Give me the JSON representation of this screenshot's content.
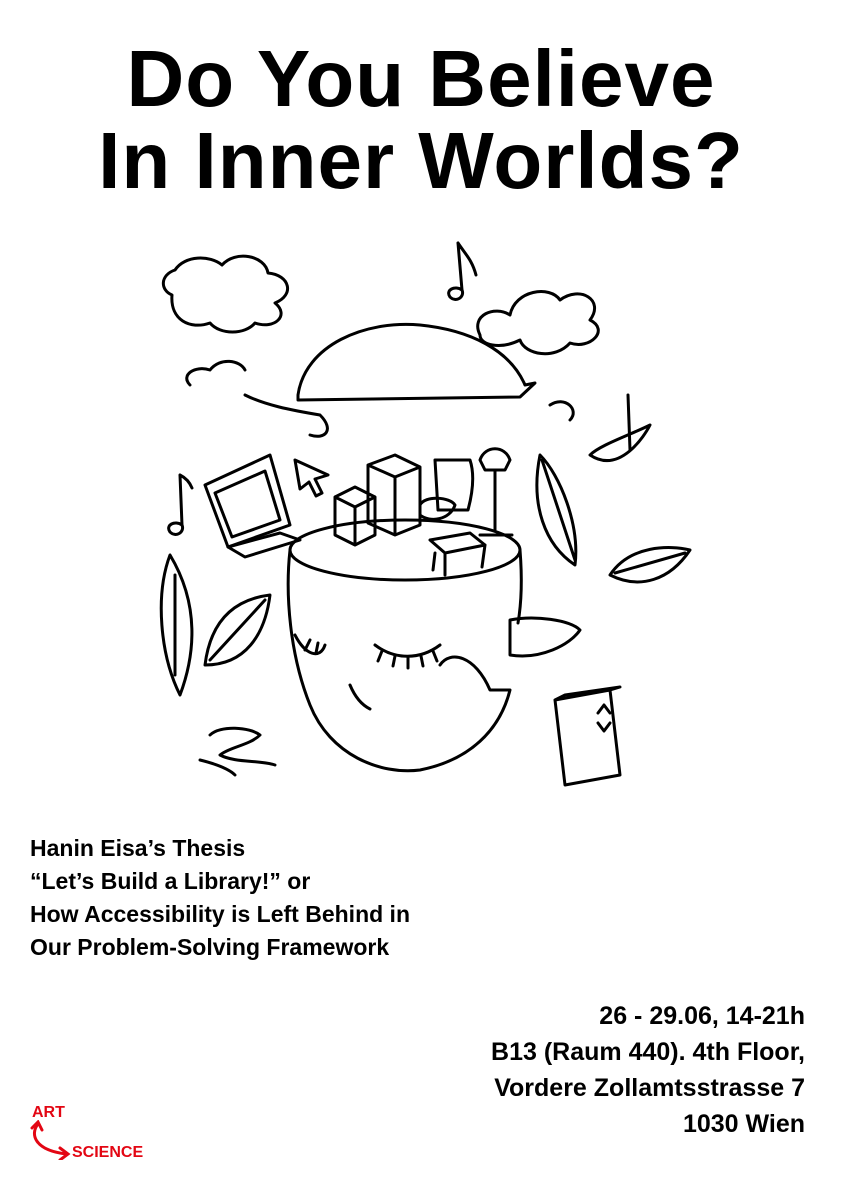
{
  "title": {
    "line1": "Do You Believe",
    "line2": "In Inner Worlds?"
  },
  "thesis": {
    "lines": [
      "Hanin Eisa’s Thesis",
      "“Let’s Build a Library!” or",
      "How Accessibility is Left Behind in",
      "Our Problem-Solving Framework"
    ]
  },
  "details": {
    "date": "26 - 29.06, 14-21h",
    "room": "B13 (Raum 440). 4th Floor,",
    "street": "Vordere Zollamtsstrasse 7",
    "city": "1030 Wien"
  },
  "logo": {
    "top": "ART",
    "bottom": "SCIENCE",
    "color": "#e30613"
  },
  "illustration": {
    "icons": [
      "cloud-icon",
      "music-note-icon",
      "laptop-icon",
      "cursor-icon",
      "head-icon",
      "leaf-icon",
      "lamp-icon",
      "chair-icon",
      "box-icon",
      "plant-icon"
    ]
  }
}
